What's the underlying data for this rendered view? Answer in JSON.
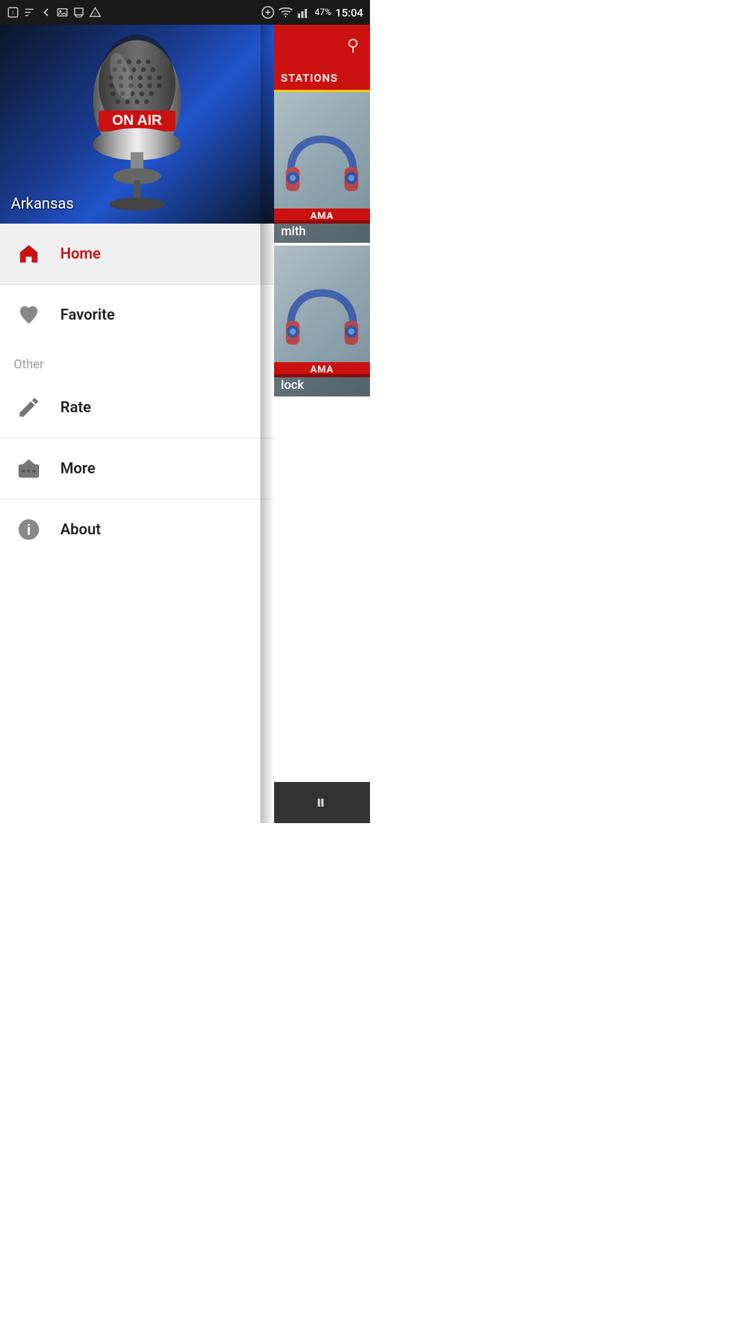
{
  "statusBar": {
    "time": "15:04",
    "battery": "47%"
  },
  "hero": {
    "label": "Arkansas",
    "onAirText": "ON AIR"
  },
  "menu": {
    "homeLabel": "Home",
    "favoriteLabel": "Favorite",
    "otherLabel": "Other",
    "rateLabel": "Rate",
    "moreLabel": "More",
    "aboutLabel": "About"
  },
  "stationsPanel": {
    "title": "STATIONS",
    "searchIconLabel": "search",
    "stations": [
      {
        "name": "mith",
        "badge": "AMA"
      },
      {
        "name": "lock",
        "badge": "AMA"
      }
    ]
  },
  "player": {
    "pauseLabel": "⏸"
  }
}
